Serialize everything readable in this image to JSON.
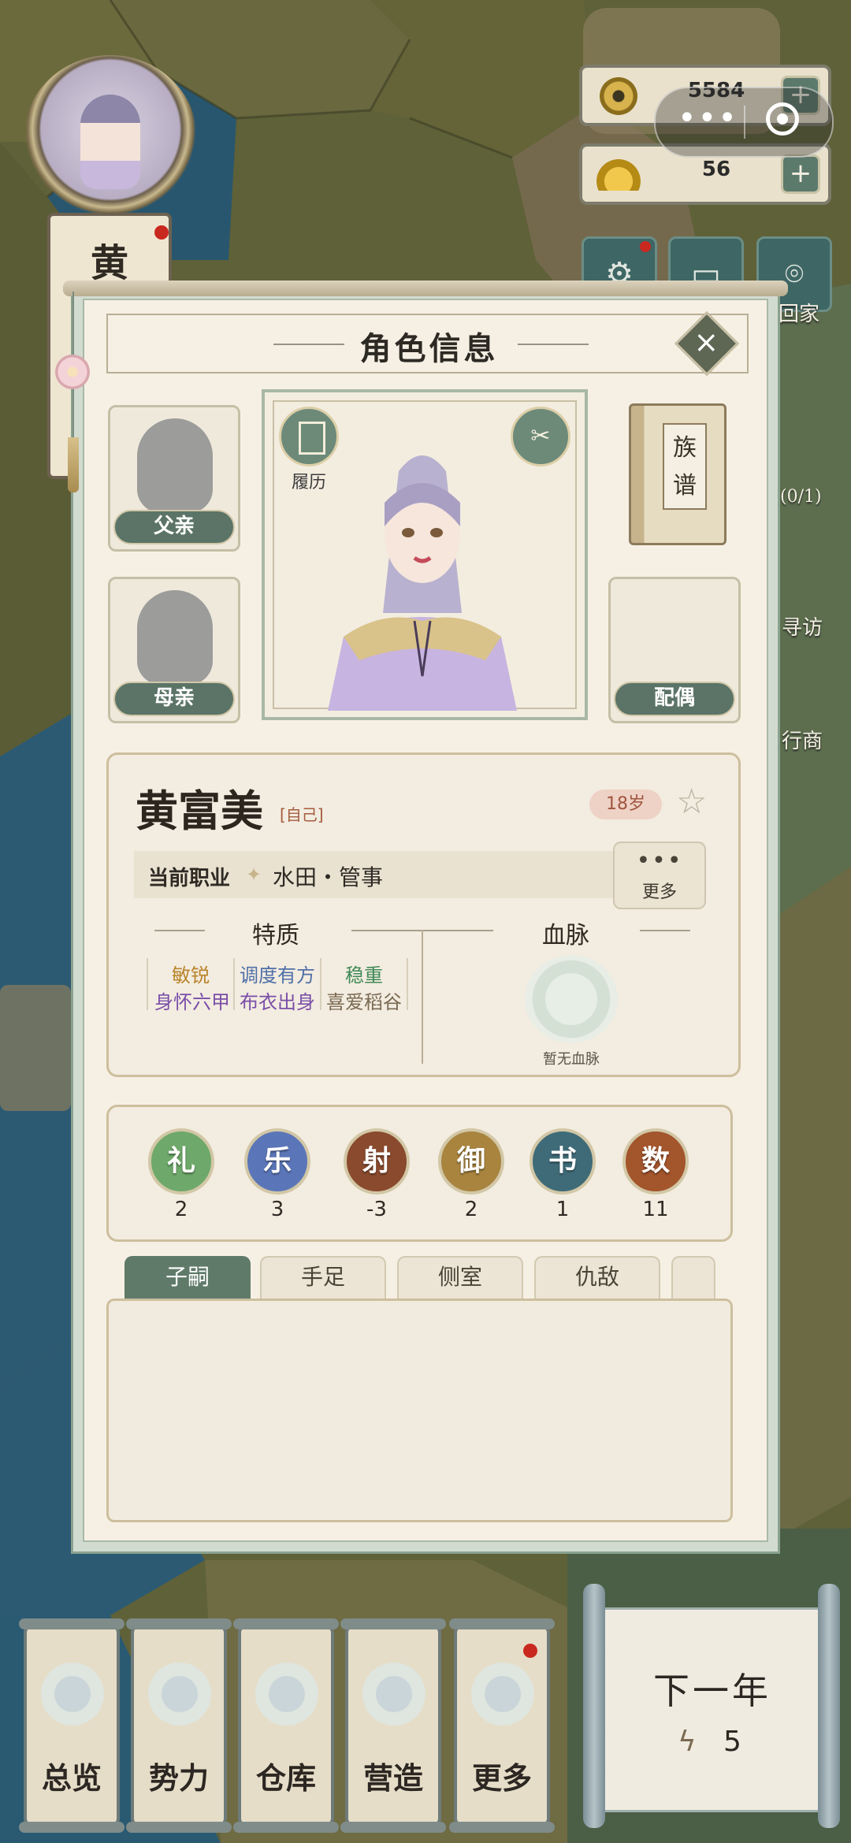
{
  "hud": {
    "player_initial": "黄",
    "coins": "5584",
    "ingots": "56",
    "plus": "+",
    "capsule_more": "•••",
    "side_labels": [
      "回家",
      "(0/1)",
      "寻访",
      "行商"
    ]
  },
  "dialog": {
    "title": "角色信息",
    "close": "×",
    "father_label": "父亲",
    "mother_label": "母亲",
    "spouse_label": "配偶",
    "resume_label": "履历",
    "genealogy_label": "族谱",
    "character": {
      "name": "黄富美",
      "self_tag": "[自己]",
      "age": "18岁",
      "job_label": "当前职业",
      "job_value": "水田・管事",
      "more_label": "更多",
      "traits_title": "特质",
      "traits": [
        {
          "text": "敏锐",
          "color": "#b8842a"
        },
        {
          "text": "调度有方",
          "color": "#4f6fa8"
        },
        {
          "text": "稳重",
          "color": "#3f8a57"
        },
        {
          "text": "身怀六甲",
          "color": "#7a4fa8"
        },
        {
          "text": "布衣出身",
          "color": "#7a4fa8"
        },
        {
          "text": "喜爱稻谷",
          "color": "#7a6a52"
        }
      ],
      "bloodline_title": "血脉",
      "bloodline_none": "暂无血脉"
    },
    "attributes": [
      {
        "char": "礼",
        "value": "2",
        "color": "#6ea86a"
      },
      {
        "char": "乐",
        "value": "3",
        "color": "#5b76b8"
      },
      {
        "char": "射",
        "value": "-3",
        "color": "#8a4a2e"
      },
      {
        "char": "御",
        "value": "2",
        "color": "#a8843f"
      },
      {
        "char": "书",
        "value": "1",
        "color": "#3f6b78"
      },
      {
        "char": "数",
        "value": "11",
        "color": "#a3552c"
      }
    ],
    "tabs": [
      "子嗣",
      "手足",
      "侧室",
      "仇敌"
    ]
  },
  "nav": {
    "items": [
      "总览",
      "势力",
      "仓库",
      "营造",
      "更多"
    ],
    "next_year": "下一年",
    "energy": "5",
    "energy_icon": "lightning-icon"
  }
}
